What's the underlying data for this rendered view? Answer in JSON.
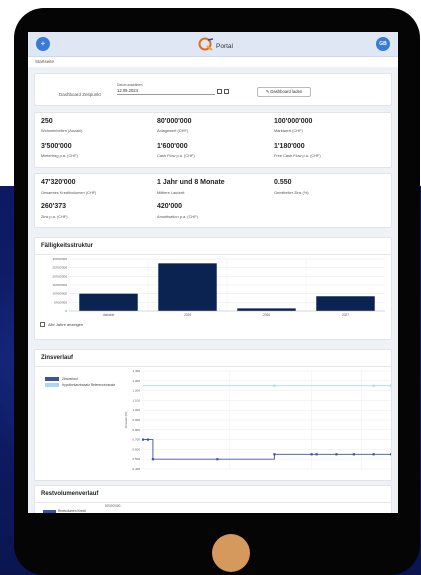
{
  "header": {
    "menu_icon": "plus-icon",
    "logo_text": "Portal",
    "avatar_initials": "GB"
  },
  "breadcrumb": "Startseite",
  "selector": {
    "label": "Dashboard Zeitpunkt",
    "date_caption": "Datum auswählen",
    "date_value": "12.09.2024",
    "load_button": "Dashboard laden"
  },
  "kpis1": [
    {
      "value": "250",
      "label": "Wohneinheiten (Anzahl)"
    },
    {
      "value": "80'000'000",
      "label": "Anlagewert (CHF)"
    },
    {
      "value": "100'000'000",
      "label": "Marktwert (CHF)"
    },
    {
      "value": "3'500'000",
      "label": "Mietertrag p.a. (CHF)"
    },
    {
      "value": "1'600'000",
      "label": "Cash Flow p.a. (CHF)"
    },
    {
      "value": "1'180'000",
      "label": "Free Cash Flow p.a. (CHF)"
    }
  ],
  "kpis2": [
    {
      "value": "47'320'000",
      "label": "Gesamtes Kreditvolumen (CHF)"
    },
    {
      "value": "1 Jahr und 8 Monate",
      "label": "Mittlere Laufzeit"
    },
    {
      "value": "0.550",
      "label": "Gemittelter Zins (%)"
    },
    {
      "value": "260'373",
      "label": "Zins p.a. (CHF)"
    },
    {
      "value": "420'000",
      "label": "Amortisation p.a. (CHF)"
    }
  ],
  "faelligkeit": {
    "title": "Fälligkeitsstruktur",
    "checkbox_label": "Alle Jahre anzeigen"
  },
  "zins": {
    "title": "Zinsverlauf"
  },
  "restvolumen": {
    "title": "Restvolumenverlauf",
    "legend_label": "Restvolumen Kredit",
    "tick_label": "50'000'000"
  },
  "colors": {
    "navy": "#0b2350",
    "accent_blue": "#3a7bd5",
    "light_series": "#a9d8f2"
  },
  "chart_data": [
    {
      "type": "bar",
      "title": "Fälligkeitsstruktur",
      "categories": [
        "Variable",
        "2025",
        "2026",
        "2027"
      ],
      "values": [
        10000000,
        27500000,
        1500000,
        8500000
      ],
      "ylim": [
        0,
        30000000
      ],
      "yticks": [
        "30'000'000",
        "25'000'000",
        "20'000'000",
        "15'000'000",
        "10'000'000",
        "5'000'000",
        "0"
      ],
      "ytick_values": [
        30000000,
        25000000,
        20000000,
        15000000,
        10000000,
        5000000,
        0
      ],
      "grid": true
    },
    {
      "type": "line",
      "title": "Zinsverlauf",
      "ylabel": "Zinssatz (%)",
      "ylim": [
        0.4,
        1.4
      ],
      "yticks": [
        "1.400",
        "1.300",
        "1.200",
        "1.100",
        "1.000",
        "0.900",
        "0.800",
        "0.700",
        "0.600",
        "0.500",
        "0.400"
      ],
      "ytick_values": [
        1.4,
        1.3,
        1.2,
        1.1,
        1.0,
        0.9,
        0.8,
        0.7,
        0.6,
        0.5,
        0.4
      ],
      "legend_position": "top-left",
      "grid": true,
      "series": [
        {
          "name": "Zinsverlauf",
          "color": "#3f51a6",
          "points": [
            [
              0,
              0.7
            ],
            [
              0.02,
              0.7
            ],
            [
              0.04,
              0.7
            ],
            [
              0.04,
              0.5
            ],
            [
              0.3,
              0.5
            ],
            [
              0.53,
              0.5
            ],
            [
              0.53,
              0.55
            ],
            [
              0.7,
              0.55
            ],
            [
              0.78,
              0.55
            ],
            [
              0.85,
              0.55
            ],
            [
              0.93,
              0.55
            ],
            [
              1,
              0.55
            ]
          ],
          "markers": [
            0,
            0.02,
            0.04,
            0.3,
            0.53,
            0.68,
            0.7,
            0.78,
            0.85,
            0.93,
            1
          ]
        },
        {
          "name": "Hypothekarzinssatz Referenzzinssatz",
          "color": "#a9d8f2",
          "points": [
            [
              0,
              1.25
            ],
            [
              0.53,
              1.25
            ],
            [
              0.93,
              1.25
            ],
            [
              1,
              1.25
            ]
          ],
          "markers": [
            0.53,
            0.93,
            1
          ]
        }
      ]
    }
  ]
}
